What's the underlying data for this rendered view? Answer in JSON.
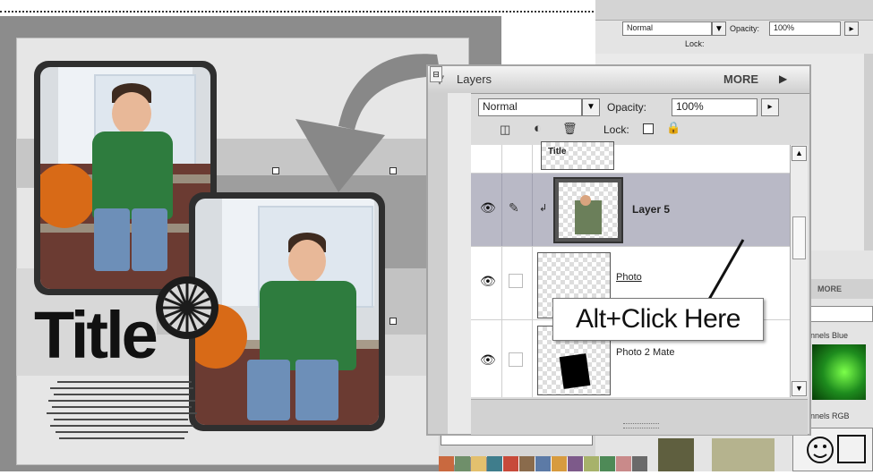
{
  "layers_panel": {
    "title": "Layers",
    "more_label": "MORE",
    "blend_mode": "Normal",
    "opacity_label": "Opacity:",
    "opacity_value": "100%",
    "lock_label": "Lock:",
    "layers": [
      {
        "name": "Title",
        "partial": true
      },
      {
        "name": "Layer 5",
        "selected": true
      },
      {
        "name": "Photo",
        "underlined": true
      },
      {
        "name": "Photo 2 Mate"
      }
    ]
  },
  "callout": {
    "text": "Alt+Click  Here"
  },
  "canvas": {
    "title": "Title"
  },
  "right_panel": {
    "blend_mode": "Normal",
    "opacity_label": "Opacity:",
    "opacity_value": "100%",
    "lock_label": "Lock:",
    "more_label": "MORE",
    "channel_blue": "nnels Blue",
    "channel_rgb": "nnels RGB"
  },
  "colors": {
    "arrow": "#8a8a8a",
    "selected_layer": "#b9b9c6",
    "swatches": [
      "#c9693f",
      "#6f8f6a",
      "#e3c06e",
      "#3f7d8c",
      "#c74a3a",
      "#8a6b4c",
      "#5c7aa6",
      "#d79b3f",
      "#7d5a8a",
      "#a7b26b",
      "#4e8a57",
      "#c98a8a",
      "#6a6a6a"
    ]
  }
}
